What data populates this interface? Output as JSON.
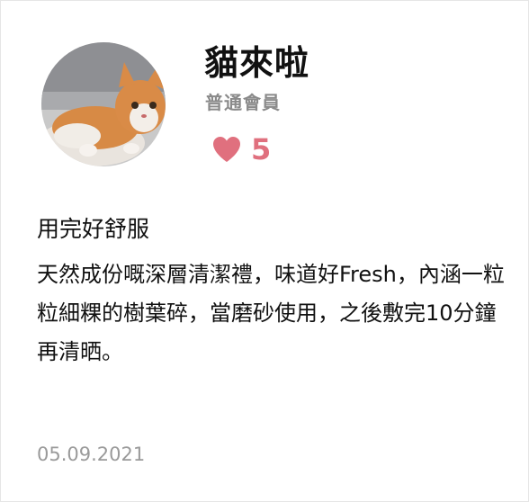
{
  "profile": {
    "username": "貓來啦",
    "member_level": "普通會員",
    "likes": "5",
    "avatar_icon": "cat-photo",
    "like_icon": "heart-icon",
    "accent_color": "#e0707e"
  },
  "review": {
    "title": "用完好舒服",
    "body": "天然成份嘅深層清潔禮，味道好Fresh，內涵一粒粒細粿的樹葉碎，當磨砂使用，之後敷完10分鐘再清晒。",
    "date": "05.09.2021"
  }
}
